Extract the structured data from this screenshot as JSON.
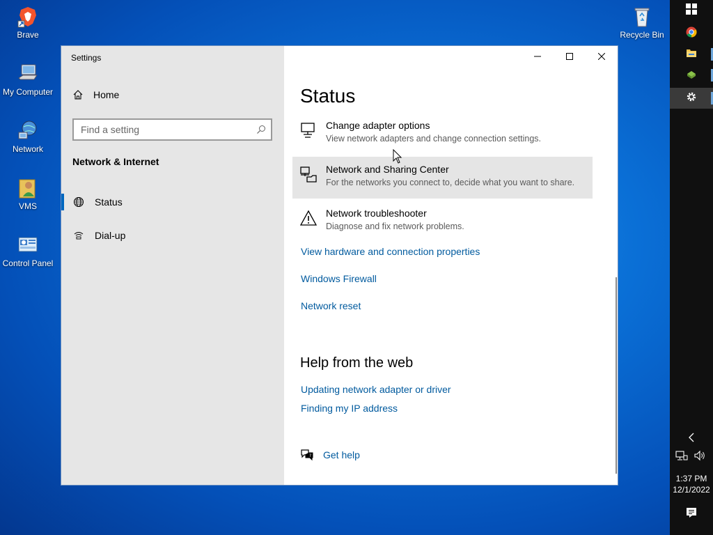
{
  "desktop": {
    "icons": [
      {
        "label": "Brave",
        "icon": "brave-icon"
      },
      {
        "label": "My Computer",
        "icon": "computer-icon"
      },
      {
        "label": "Network",
        "icon": "network-icon"
      },
      {
        "label": "VMS",
        "icon": "user-folder-icon"
      },
      {
        "label": "Control Panel",
        "icon": "control-panel-icon"
      },
      {
        "label": "Recycle Bin",
        "icon": "recycle-bin-icon"
      }
    ]
  },
  "taskbar": {
    "apps": [
      "windows-start-icon",
      "chrome-icon",
      "file-explorer-icon",
      "app-icon",
      "settings-gear-icon"
    ],
    "time": "1:37 PM",
    "date": "12/1/2022"
  },
  "window": {
    "title": "Settings",
    "sidebar": {
      "home_label": "Home",
      "search_placeholder": "Find a setting",
      "section_title": "Network & Internet",
      "items": [
        {
          "label": "Status",
          "icon": "globe-icon",
          "selected": true
        },
        {
          "label": "Dial-up",
          "icon": "dialup-icon",
          "selected": false
        }
      ]
    },
    "content": {
      "title": "Status",
      "items": [
        {
          "title": "Change adapter options",
          "desc": "View network adapters and change connection settings.",
          "icon": "adapter-icon"
        },
        {
          "title": "Network and Sharing Center",
          "desc": "For the networks you connect to, decide what you want to share.",
          "icon": "sharing-center-icon"
        },
        {
          "title": "Network troubleshooter",
          "desc": "Diagnose and fix network problems.",
          "icon": "warning-icon"
        }
      ],
      "links": [
        "View hardware and connection properties",
        "Windows Firewall",
        "Network reset"
      ],
      "help_title": "Help from the web",
      "help_links": [
        "Updating network adapter or driver",
        "Finding my IP address"
      ],
      "get_help": "Get help"
    }
  },
  "colors": {
    "accent": "#0067c0",
    "link": "#005a9e",
    "sidebar_bg": "#e6e6e6"
  }
}
